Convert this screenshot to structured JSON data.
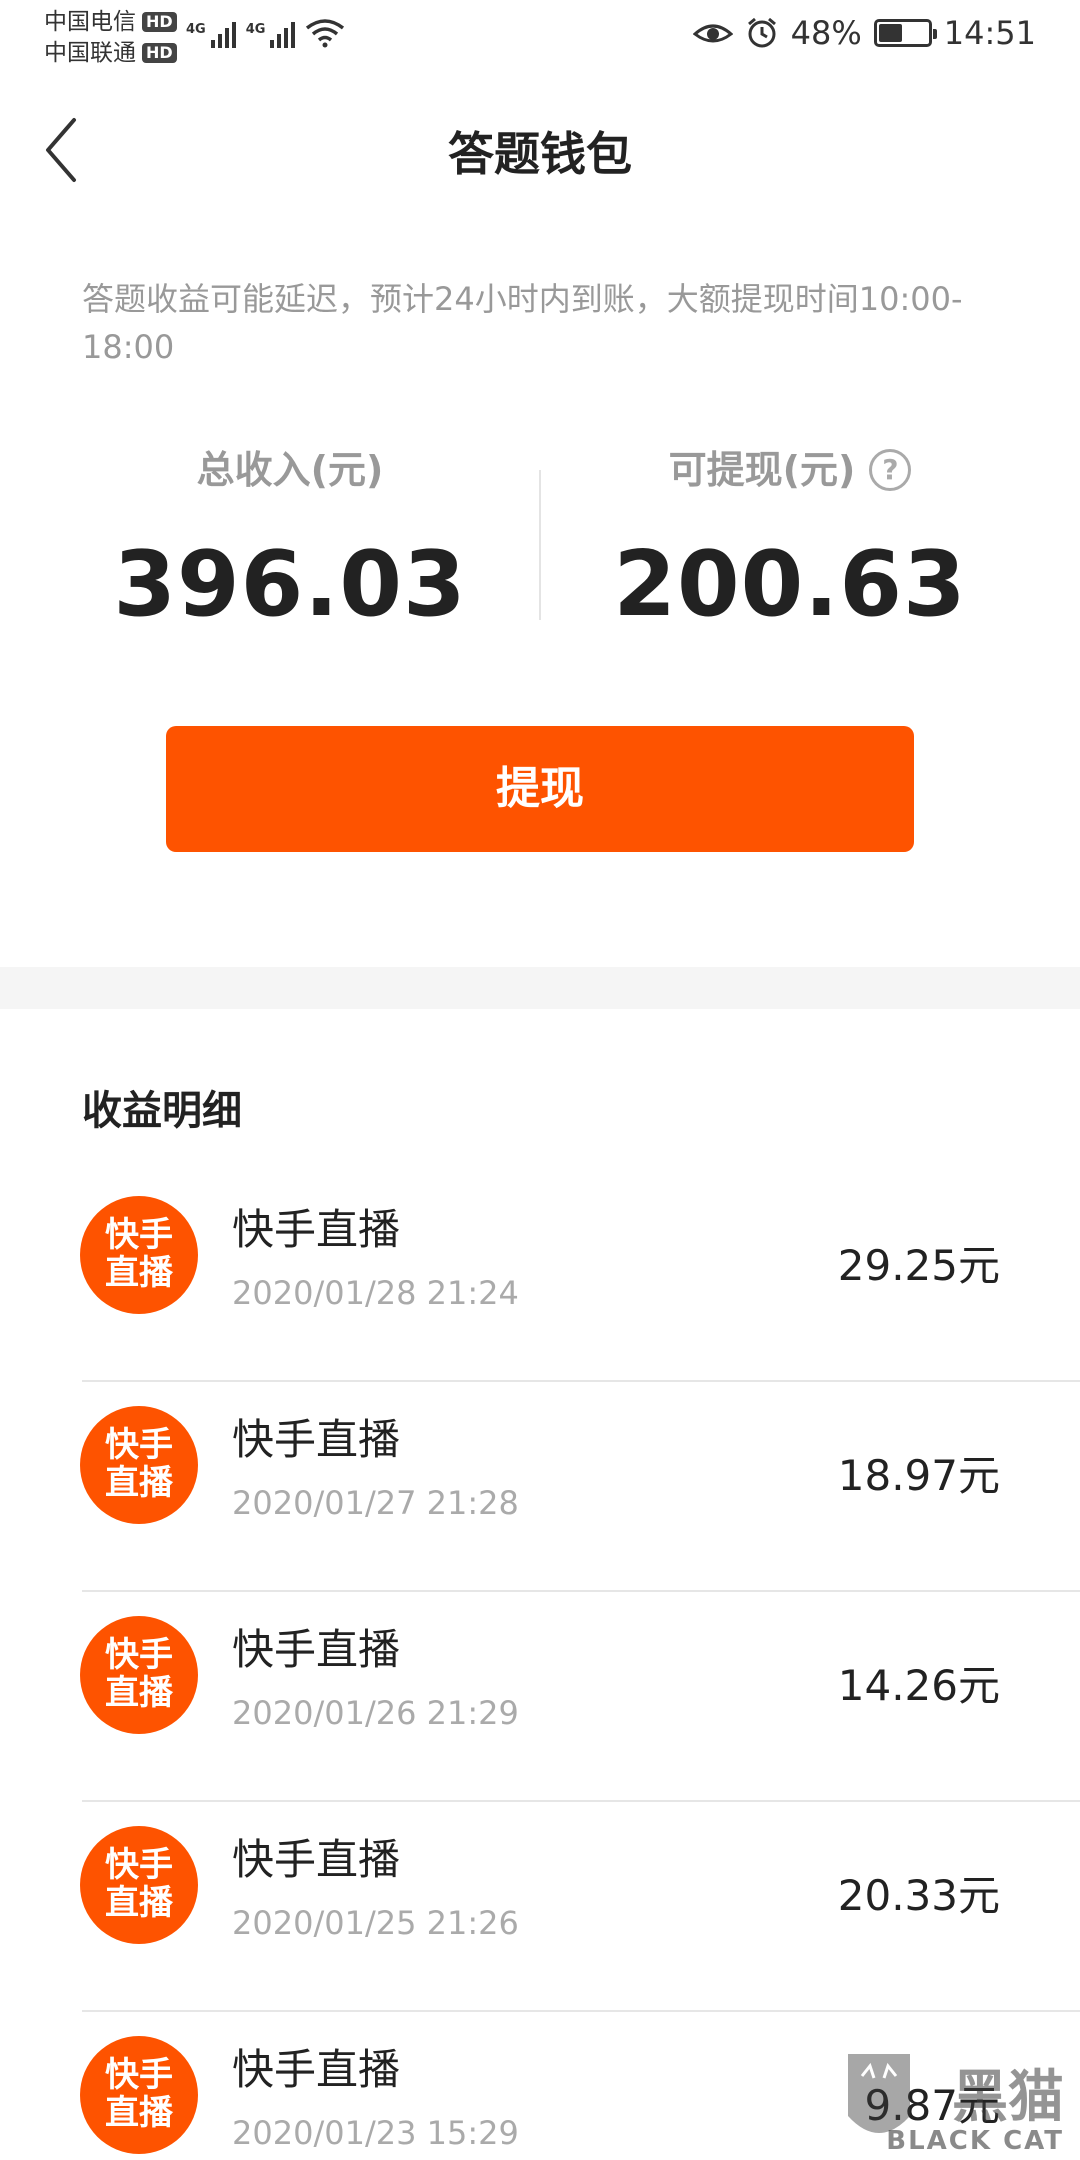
{
  "status_bar": {
    "carrier_1": "中国电信",
    "carrier_2": "中国联通",
    "hd_label": "HD",
    "network_label": "4G",
    "battery_percent": "48%",
    "battery_level": 0.48,
    "time": "14:51"
  },
  "header": {
    "title": "答题钱包"
  },
  "notice": "答题收益可能延迟，预计24小时内到账，大额提现时间10:00-18:00",
  "stats": {
    "total_label": "总收入(元)",
    "total_value": "396.03",
    "withdrawable_label": "可提现(元)",
    "withdrawable_value": "200.63",
    "help_glyph": "?"
  },
  "withdraw_button": "提现",
  "section_title": "收益明细",
  "records": [
    {
      "badge_line1": "快手",
      "badge_line2": "直播",
      "name": "快手直播",
      "time": "2020/01/28 21:24",
      "amount": "29.25元"
    },
    {
      "badge_line1": "快手",
      "badge_line2": "直播",
      "name": "快手直播",
      "time": "2020/01/27 21:28",
      "amount": "18.97元"
    },
    {
      "badge_line1": "快手",
      "badge_line2": "直播",
      "name": "快手直播",
      "time": "2020/01/26 21:29",
      "amount": "14.26元"
    },
    {
      "badge_line1": "快手",
      "badge_line2": "直播",
      "name": "快手直播",
      "time": "2020/01/25 21:26",
      "amount": "20.33元"
    },
    {
      "badge_line1": "快手",
      "badge_line2": "直播",
      "name": "快手直播",
      "time": "2020/01/23 15:29",
      "amount": "9.87元"
    }
  ],
  "watermark": {
    "text": "黑猫",
    "sub": "BLACK CAT"
  },
  "colors": {
    "accent": "#fe5300",
    "muted": "#999999",
    "text": "#222222"
  }
}
